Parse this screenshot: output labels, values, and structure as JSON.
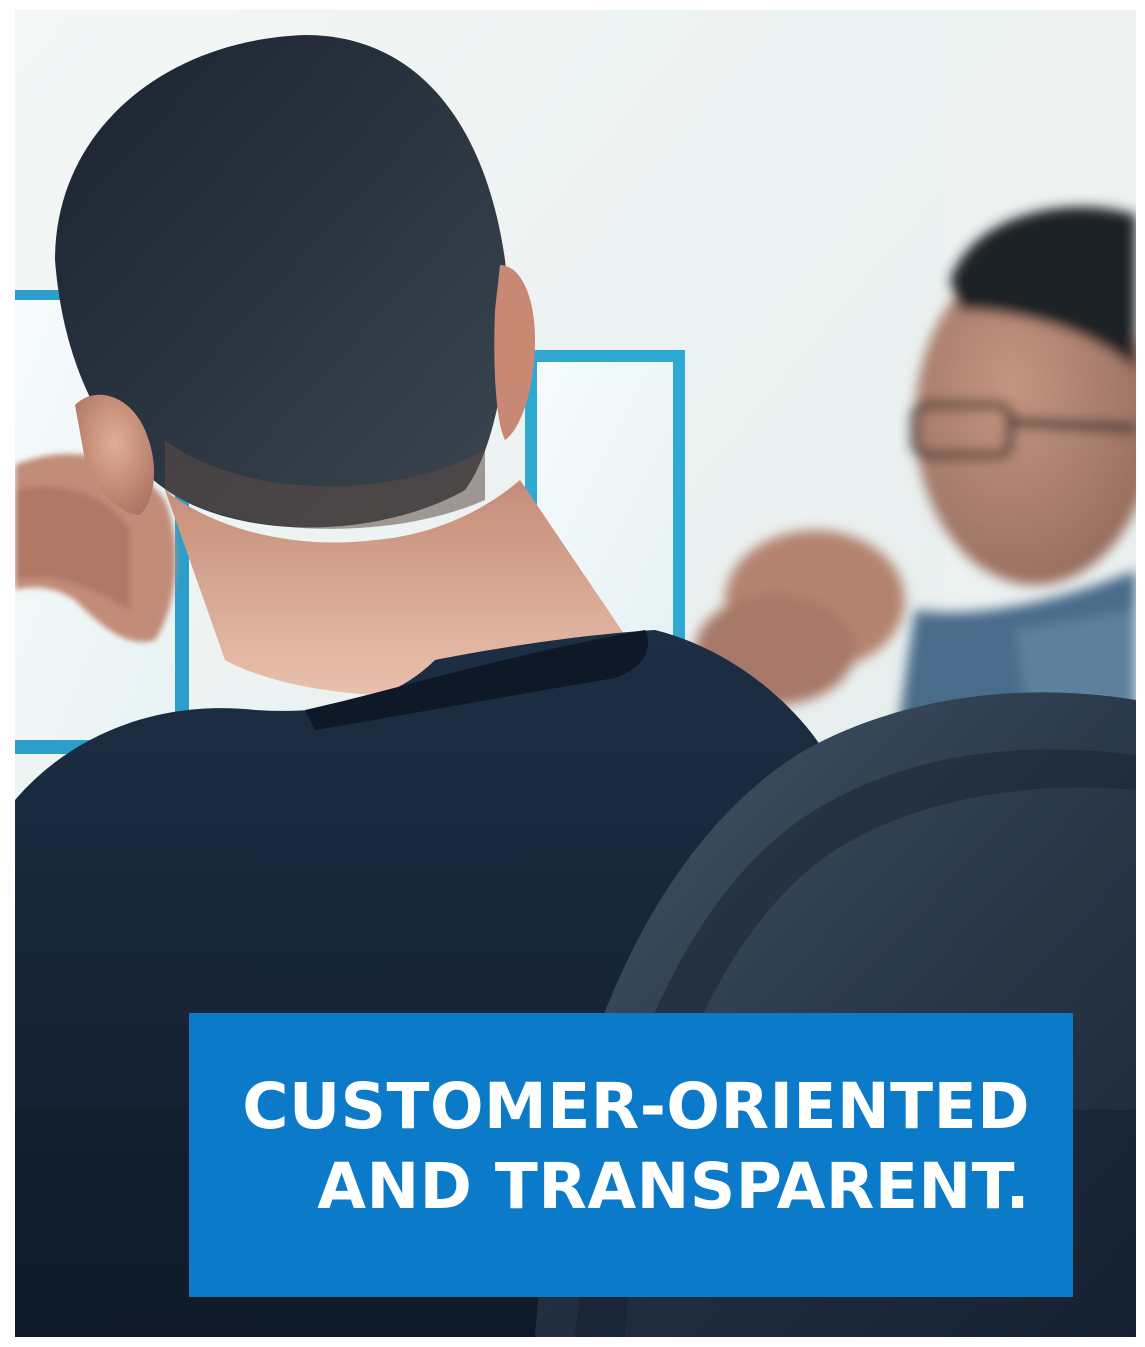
{
  "photo": {
    "subject": "two-men-at-computer-monitors"
  },
  "caption": {
    "line1": "CUSTOMER-ORIENTED",
    "line2": "AND TRANSPARENT."
  },
  "colors": {
    "caption_background": "#0a7ac9",
    "caption_text": "#ffffff",
    "shirt_navy": "#142234",
    "monitor_frame": "#2fa9d4"
  }
}
